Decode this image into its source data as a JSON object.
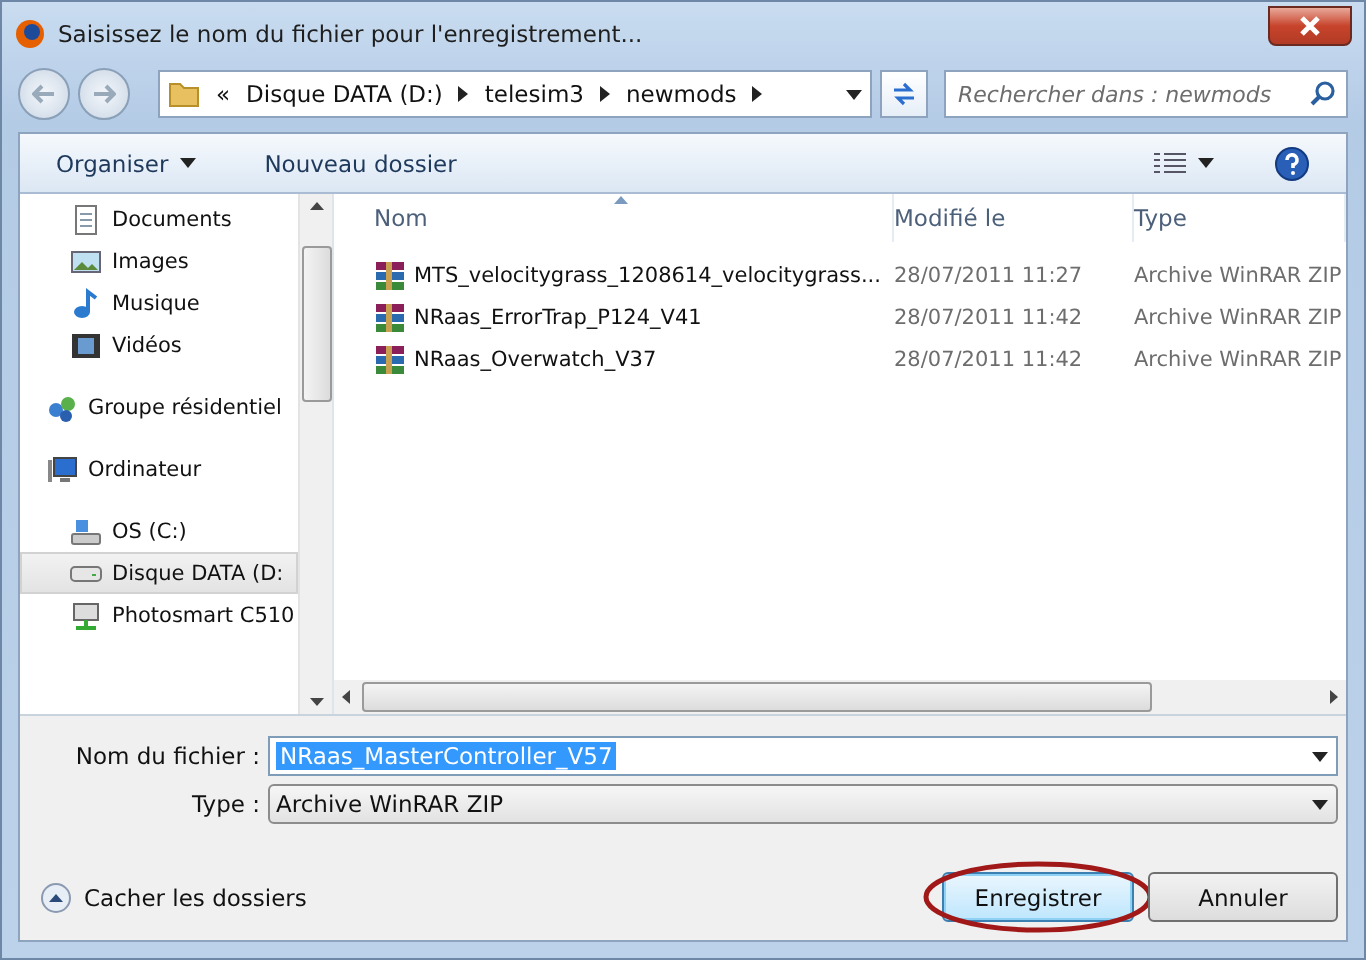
{
  "window": {
    "title": "Saisissez le nom du fichier pour l'enregistrement..."
  },
  "address": {
    "overflow": "«",
    "crumbs": [
      "Disque DATA (D:)",
      "telesim3",
      "newmods"
    ]
  },
  "search": {
    "placeholder": "Rechercher dans : newmods"
  },
  "toolbar": {
    "organize": "Organiser",
    "new_folder": "Nouveau dossier"
  },
  "sidebar": {
    "items": [
      {
        "kind": "documents",
        "label": "Documents",
        "group": false,
        "selected": false
      },
      {
        "kind": "images",
        "label": "Images",
        "group": false,
        "selected": false
      },
      {
        "kind": "music",
        "label": "Musique",
        "group": false,
        "selected": false
      },
      {
        "kind": "videos",
        "label": "Vidéos",
        "group": false,
        "selected": false
      },
      {
        "kind": "homegroup",
        "label": "Groupe résidentiel",
        "group": true,
        "selected": false
      },
      {
        "kind": "computer",
        "label": "Ordinateur",
        "group": true,
        "selected": false
      },
      {
        "kind": "osdrive",
        "label": "OS (C:)",
        "group": false,
        "selected": false
      },
      {
        "kind": "drive",
        "label": "Disque DATA (D:",
        "group": false,
        "selected": true
      },
      {
        "kind": "printer",
        "label": "Photosmart C510",
        "group": false,
        "selected": false
      }
    ]
  },
  "table": {
    "columns": [
      "Nom",
      "Modifié le",
      "Type"
    ],
    "rows": [
      {
        "name": "MTS_velocitygrass_1208614_velocitygrass...",
        "modified": "28/07/2011 11:27",
        "type": "Archive WinRAR ZIP"
      },
      {
        "name": "NRaas_ErrorTrap_P124_V41",
        "modified": "28/07/2011 11:42",
        "type": "Archive WinRAR ZIP"
      },
      {
        "name": "NRaas_Overwatch_V37",
        "modified": "28/07/2011 11:42",
        "type": "Archive WinRAR ZIP"
      }
    ]
  },
  "filename": {
    "label": "Nom du fichier :",
    "value": "NRaas_MasterController_V57"
  },
  "filetype": {
    "label": "Type :",
    "value": "Archive WinRAR ZIP"
  },
  "hide_folders": "Cacher les dossiers",
  "buttons": [
    {
      "label": "Enregistrer",
      "default": true,
      "circled": true
    },
    {
      "label": "Annuler",
      "default": false,
      "circled": false
    }
  ]
}
